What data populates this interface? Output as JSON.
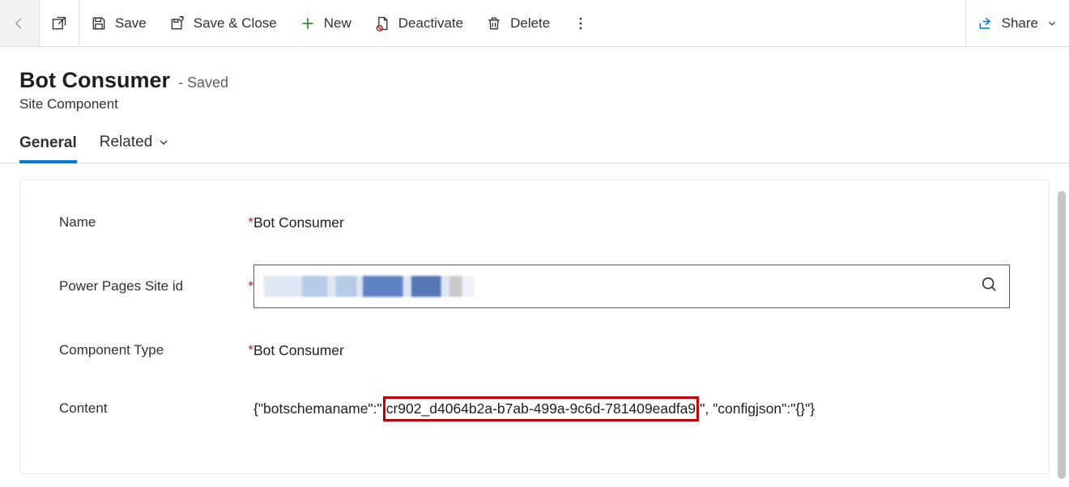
{
  "toolbar": {
    "save": "Save",
    "save_close": "Save & Close",
    "new": "New",
    "deactivate": "Deactivate",
    "delete": "Delete",
    "share": "Share"
  },
  "header": {
    "title": "Bot Consumer",
    "status": "- Saved",
    "subtitle": "Site Component"
  },
  "tabs": {
    "general": "General",
    "related": "Related"
  },
  "form": {
    "name": {
      "label": "Name",
      "required": "*",
      "value": "Bot Consumer"
    },
    "site_id": {
      "label": "Power Pages Site id",
      "required": "*"
    },
    "component_type": {
      "label": "Component Type",
      "required": "*",
      "value": "Bot Consumer"
    },
    "content": {
      "label": "Content",
      "prefix": "{\"botschemaname\":\"",
      "highlight": "cr902_d4064b2a-b7ab-499a-9c6d-781409eadfa9",
      "suffix": "\", \"configjson\":\"{}\"}"
    }
  }
}
